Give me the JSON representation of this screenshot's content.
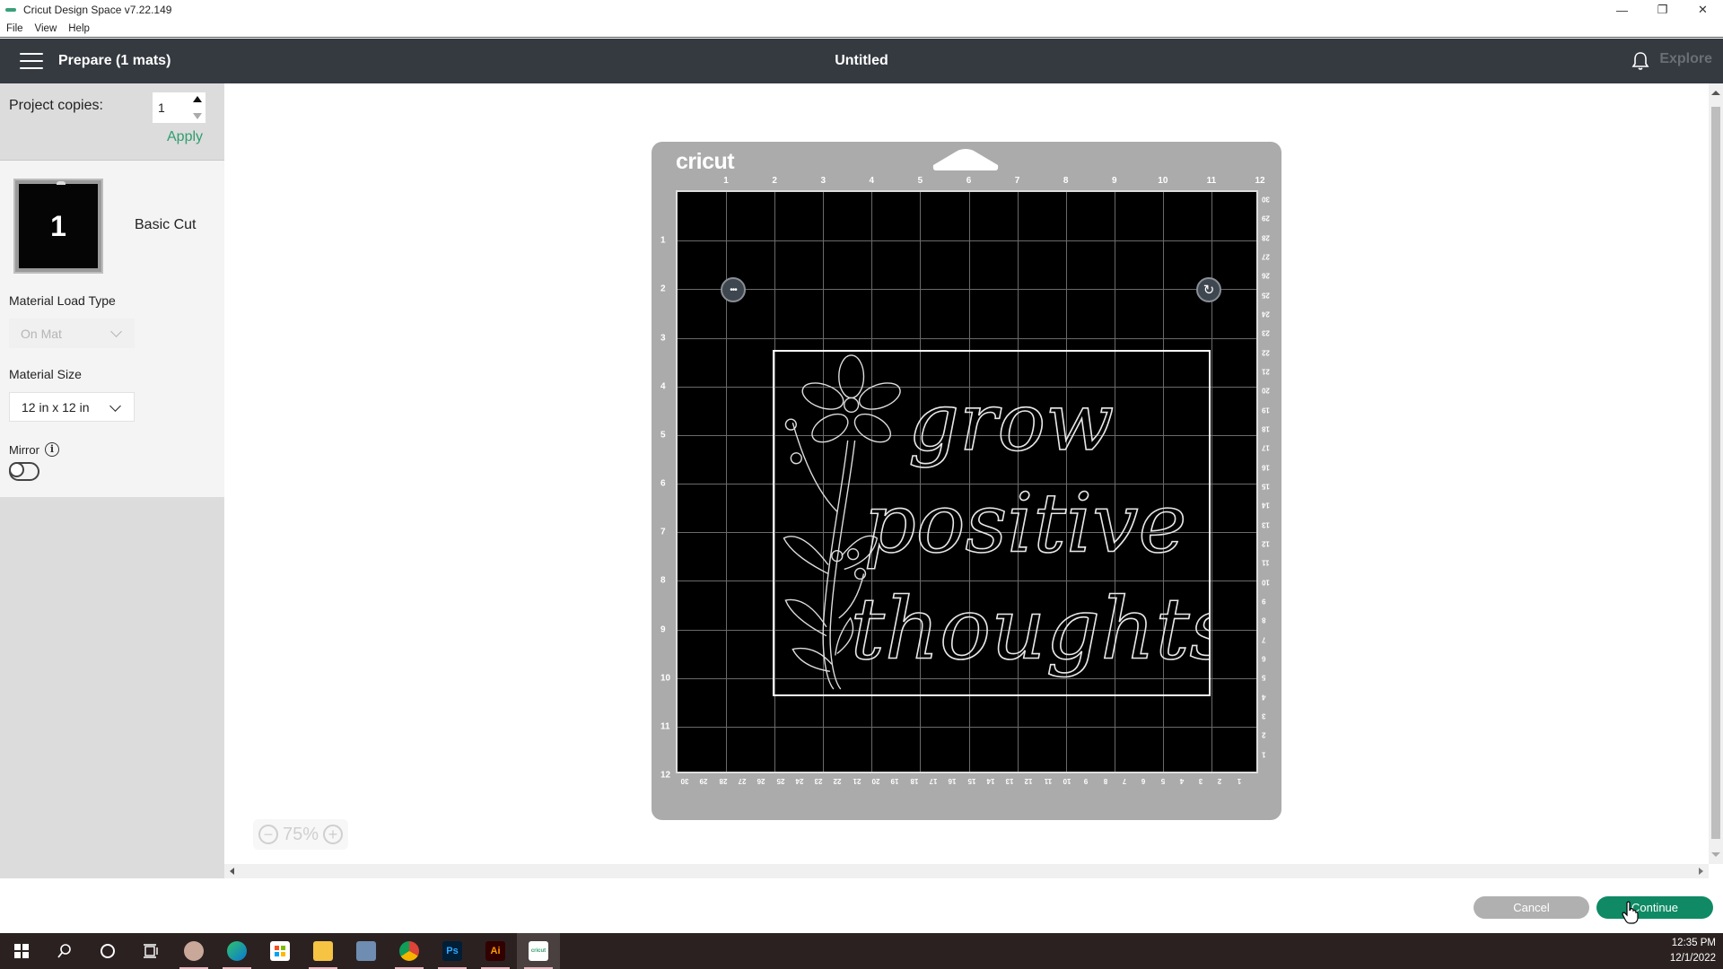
{
  "window": {
    "title": "Cricut Design Space  v7.22.149",
    "controls": {
      "minimize": "—",
      "restore": "❐",
      "close": "✕"
    }
  },
  "menubar": {
    "items": [
      "File",
      "View",
      "Help"
    ]
  },
  "header": {
    "left_title": "Prepare (1 mats)",
    "center_title": "Untitled",
    "explore_label": "Explore"
  },
  "left_panel": {
    "copies_label": "Project copies:",
    "copies_value": "1",
    "apply_label": "Apply",
    "mat": {
      "number": "1",
      "name": "Basic Cut"
    },
    "material_load_type": {
      "label": "Material Load Type",
      "value": "On Mat",
      "disabled": true
    },
    "material_size": {
      "label": "Material Size",
      "value": "12 in x 12 in"
    },
    "mirror": {
      "label": "Mirror",
      "info_icon": "i",
      "on": false
    }
  },
  "mat_preview": {
    "brand": "cricut",
    "ruler_top_in": [
      "1",
      "2",
      "3",
      "4",
      "5",
      "6",
      "7",
      "8",
      "9",
      "10",
      "11",
      "12"
    ],
    "ruler_left_in": [
      "1",
      "2",
      "3",
      "4",
      "5",
      "6",
      "7",
      "8",
      "9",
      "10",
      "11",
      "12"
    ],
    "ruler_right_cm": [
      "30",
      "29",
      "28",
      "27",
      "26",
      "25",
      "24",
      "23",
      "22",
      "21",
      "20",
      "19",
      "18",
      "17",
      "16",
      "15",
      "14",
      "13",
      "12",
      "11",
      "10",
      "9",
      "8",
      "7",
      "6",
      "5",
      "4",
      "3",
      "2",
      "1"
    ],
    "ruler_bottom_cm": [
      "30",
      "29",
      "28",
      "27",
      "26",
      "25",
      "24",
      "23",
      "22",
      "21",
      "20",
      "19",
      "18",
      "17",
      "16",
      "15",
      "14",
      "13",
      "12",
      "11",
      "10",
      "9",
      "8",
      "7",
      "6",
      "5",
      "4",
      "3",
      "2",
      "1"
    ],
    "design_text": [
      "grow",
      "positive",
      "thoughts"
    ],
    "more_button": "•••",
    "rotate_button": "↻"
  },
  "zoom": {
    "value": "75%",
    "minus": "−",
    "plus": "+"
  },
  "actions": {
    "cancel_label": "Cancel",
    "continue_label": "Continue"
  },
  "colors": {
    "header_bg": "#353a40",
    "accent_green": "#0f8a64",
    "apply_green": "#2f9e6f",
    "mat_gray": "#ababab"
  },
  "taskbar": {
    "items": [
      "windows-start",
      "search",
      "cortana",
      "task-view",
      "snip-sketch",
      "edge",
      "microsoft-store",
      "file-explorer",
      "calculator",
      "chrome",
      "photoshop",
      "illustrator",
      "cricut-design-space"
    ],
    "labels": {
      "ps": "Ps",
      "ai": "Ai",
      "cricut": "cricut"
    },
    "time": "12:35 PM",
    "date": "12/1/2022"
  }
}
